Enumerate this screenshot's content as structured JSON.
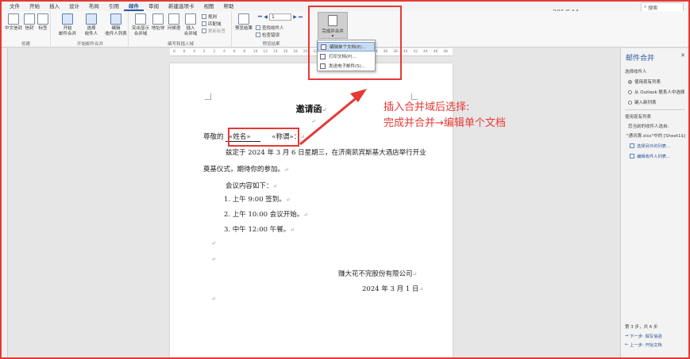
{
  "menu": {
    "items": [
      "文件",
      "开始",
      "插入",
      "设计",
      "布局",
      "引用",
      "邮件",
      "审阅",
      "新建选项卡",
      "视图",
      "帮助"
    ],
    "active_index": 6
  },
  "page_counter": "395/544",
  "search": {
    "placeholder": "搜索"
  },
  "ribbon": {
    "groups": {
      "create": {
        "label": "创建",
        "btn1": "中文信封",
        "btn2": "信封",
        "btn3": "标签"
      },
      "start": {
        "label": "开始邮件合并",
        "btn1": "开始\n邮件合并",
        "btn2": "选择\n收件人",
        "btn3": "编辑\n收件人列表"
      },
      "write": {
        "label": "编写和插入域",
        "btn1": "突出显示\n合并域",
        "btn2": "地址块",
        "btn3": "问候语",
        "btn4": "插入\n合并域",
        "s1": "规则",
        "s2": "匹配域",
        "s3": "更新标签"
      },
      "preview": {
        "label": "预览结果",
        "btn1": "预览结果",
        "record": "1",
        "s1": "查找收件人",
        "s2": "检查错误"
      },
      "finish": {
        "label": "完成",
        "btn": "完成并合并"
      }
    }
  },
  "dropdown": {
    "items": [
      "编辑单个文档(E)...",
      "打印文档(P)...",
      "发送电子邮件(S)..."
    ],
    "highlighted_index": 0
  },
  "ruler_ticks": [
    "8",
    "6",
    "4",
    "2",
    "2",
    "4",
    "6",
    "8",
    "10",
    "12",
    "14",
    "16",
    "18",
    "20",
    "22",
    "24",
    "26",
    "28",
    "30",
    "32",
    "34",
    "36",
    "38",
    "40",
    "42",
    "44",
    "46",
    "48"
  ],
  "document": {
    "title": "邀请函",
    "greeting": "尊敬的",
    "field_name": "«姓名»",
    "field_title": "«称谓»",
    "colon": "：",
    "para1_line1": "兹定于 2024 年 3 月 6 日星期三，在济南凯宾斯基大酒店举行开业",
    "para1_line2": "奠基仪式，期待你的参加。",
    "agenda": "会议内容如下：",
    "item1": "1. 上午 9:00 签到。",
    "item2": "2. 上午 10:00 会议开始。",
    "item3": "3. 中午 12:00 午餐。",
    "company": "赚大花不完股份有限公司",
    "date": "2024 年 3 月 1 日",
    "para_mark": "↵"
  },
  "annotation": {
    "line1": "插入合并域后选择:",
    "line2": "完成并合并→编辑单个文档"
  },
  "pane": {
    "title": "邮件合并",
    "close": "✕",
    "section1": "选择收件人",
    "opt1": "使用现有列表",
    "opt2": "从 Outlook 联系人中选择",
    "opt3": "键入新列表",
    "section2": "使用现有列表",
    "source_label": "您当前的收件人选自:",
    "source_value": "\"通讯簿.xlsx\"中的 [Sheet1$]",
    "link1": "选择另外的列表...",
    "link2": "编辑收件人列表...",
    "step": "第 3 步，共 6 步",
    "next": "下一步: 撰写信函",
    "prev": "上一步: 开始文档"
  },
  "colors": {
    "accent": "#2b579a",
    "highlight_red": "#e53935"
  }
}
